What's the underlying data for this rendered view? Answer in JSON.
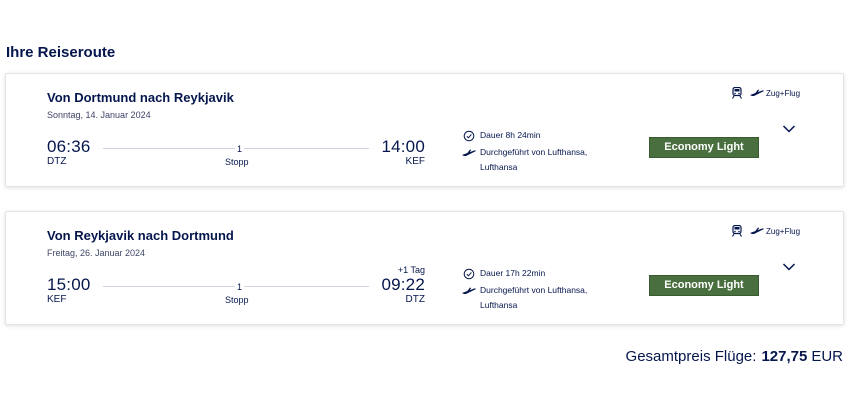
{
  "section_title": "Ihre Reiseroute",
  "segments": [
    {
      "title": "Von Dortmund nach Reykjavik",
      "date": "Sonntag, 14. Januar 2024",
      "departure_time": "06:36",
      "departure_code": "DTZ",
      "arrival_time": "14:00",
      "arrival_code": "KEF",
      "arrival_day_offset": "",
      "stops_count": "1",
      "stops_label": "Stopp",
      "duration": "Dauer 8h 24min",
      "operated_by_line1": "Durchgeführt von Lufthansa,",
      "operated_by_line2": "Lufthansa",
      "fare": "Economy Light",
      "modal": "Zug+Flug"
    },
    {
      "title": "Von Reykjavik nach Dortmund",
      "date": "Freitag, 26. Januar 2024",
      "departure_time": "15:00",
      "departure_code": "KEF",
      "arrival_time": "09:22",
      "arrival_code": "DTZ",
      "arrival_day_offset": "+1 Tag",
      "stops_count": "1",
      "stops_label": "Stopp",
      "duration": "Dauer 17h 22min",
      "operated_by_line1": "Durchgeführt von Lufthansa,",
      "operated_by_line2": "Lufthansa",
      "fare": "Economy Light",
      "modal": "Zug+Flug"
    }
  ],
  "total": {
    "label": "Gesamtpreis Flüge:",
    "amount": "127,75",
    "currency": "EUR"
  },
  "colors": {
    "brand_navy": "#05164d",
    "fare_green": "#4a6f3f"
  },
  "icons": [
    "clock-icon",
    "plane-icon",
    "train-icon",
    "chevron-down-icon"
  ]
}
